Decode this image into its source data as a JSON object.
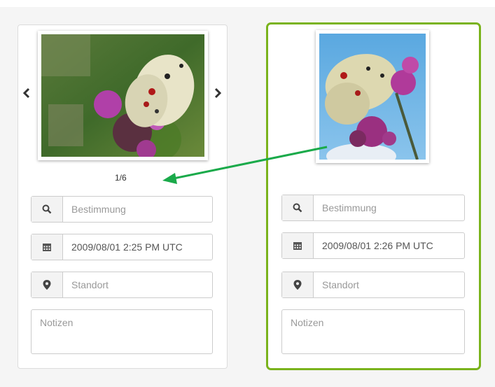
{
  "left_card": {
    "counter": "1/6",
    "search_placeholder": "Bestimmung",
    "date_value": "2009/08/01 2:25 PM UTC",
    "location_placeholder": "Standort",
    "notes_placeholder": "Notizen"
  },
  "right_card": {
    "search_placeholder": "Bestimmung",
    "date_value": "2009/08/01 2:26 PM UTC",
    "location_placeholder": "Standort",
    "notes_placeholder": "Notizen"
  },
  "icons": {
    "prev": "chevron-left-icon",
    "next": "chevron-right-icon",
    "search": "search-icon",
    "calendar": "calendar-icon",
    "location": "map-marker-icon"
  },
  "colors": {
    "selected_border": "#7ab31c",
    "link_arrow": "#1aaa4a"
  }
}
